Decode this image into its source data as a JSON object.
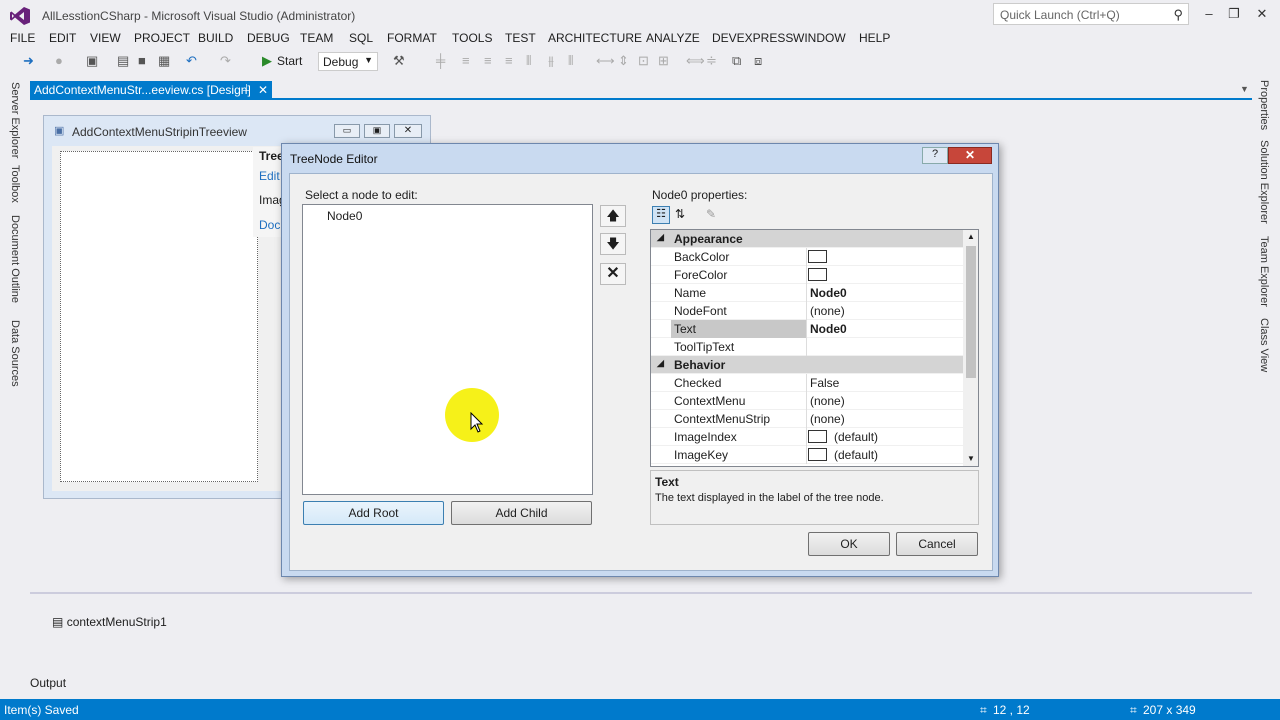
{
  "window": {
    "title": "AllLesstionCSharp - Microsoft Visual Studio (Administrator)",
    "quick_launch_placeholder": "Quick Launch (Ctrl+Q)"
  },
  "menu": [
    "FILE",
    "EDIT",
    "VIEW",
    "PROJECT",
    "BUILD",
    "DEBUG",
    "TEAM",
    "SQL",
    "FORMAT",
    "TOOLS",
    "TEST",
    "ARCHITECTURE",
    "ANALYZE",
    "DEVEXPRESS",
    "WINDOW",
    "HELP"
  ],
  "toolbar": {
    "start_label": "Start",
    "config_value": "Debug"
  },
  "left_side_tabs": [
    "Server Explorer",
    "Toolbox",
    "Document Outline",
    "Data Sources"
  ],
  "right_side_tabs": [
    "Properties",
    "Solution Explorer",
    "Team Explorer",
    "Class View"
  ],
  "doc_tab": {
    "label": "AddContextMenuStr...eeview.cs [Design]",
    "pin": "⊥",
    "close": "✕"
  },
  "form": {
    "title": "AddContextMenuStripinTreeview",
    "smart_tag": [
      "Tree",
      "Edit",
      "Imag",
      "Doc"
    ]
  },
  "component_tray": {
    "item": "contextMenuStrip1"
  },
  "output_label": "Output",
  "status": {
    "message": "Item(s) Saved",
    "position": "12 , 12",
    "size": "207 x 349"
  },
  "dialog": {
    "title": "TreeNode Editor",
    "help_label": "?",
    "close_label": "✕",
    "select_label": "Select a node to edit:",
    "nodes": [
      "Node0"
    ],
    "add_root_label": "Add Root",
    "add_child_label": "Add Child",
    "props_label": "Node0 properties:",
    "properties": [
      {
        "category": "Appearance"
      },
      {
        "name": "BackColor",
        "value": "",
        "swatch": true
      },
      {
        "name": "ForeColor",
        "value": "",
        "swatch": true
      },
      {
        "name": "Name",
        "value": "Node0",
        "bold": true
      },
      {
        "name": "NodeFont",
        "value": "(none)"
      },
      {
        "name": "Text",
        "value": "Node0",
        "bold": true,
        "selected": true
      },
      {
        "name": "ToolTipText",
        "value": ""
      },
      {
        "category": "Behavior"
      },
      {
        "name": "Checked",
        "value": "False"
      },
      {
        "name": "ContextMenu",
        "value": "(none)"
      },
      {
        "name": "ContextMenuStrip",
        "value": "(none)"
      },
      {
        "name": "ImageIndex",
        "value": "(default)",
        "swatch": true
      },
      {
        "name": "ImageKey",
        "value": "(default)",
        "swatch": true
      }
    ],
    "description_title": "Text",
    "description_text": "The text displayed in the label of the tree node.",
    "ok_label": "OK",
    "cancel_label": "Cancel"
  },
  "colors": {
    "accent": "#007acc",
    "highlight": "#f5f000"
  }
}
